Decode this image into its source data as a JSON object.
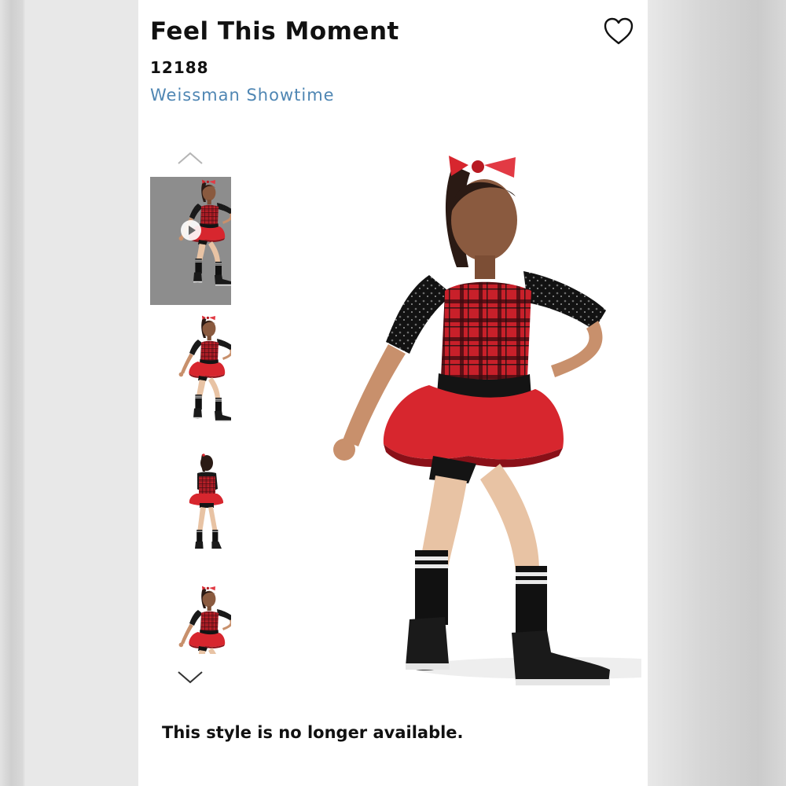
{
  "product": {
    "title": "Feel This Moment",
    "sku": "12188",
    "brand": "Weissman Showtime",
    "availability": "This style is no longer available."
  },
  "icons": {
    "favorite": "heart-outline-icon",
    "scroll_up": "chevron-up-icon",
    "scroll_down": "chevron-down-icon",
    "video": "play-icon"
  },
  "gallery": {
    "thumbnails": [
      {
        "view": "front",
        "has_video": true,
        "selected": true
      },
      {
        "view": "front",
        "has_video": false,
        "selected": false
      },
      {
        "view": "back",
        "has_video": false,
        "selected": false
      },
      {
        "view": "front",
        "has_video": false,
        "selected": false
      }
    ]
  },
  "colors": {
    "title": "#111111",
    "brand_link": "#4f86b3",
    "costume_red": "#d7262e",
    "costume_black": "#141414"
  }
}
